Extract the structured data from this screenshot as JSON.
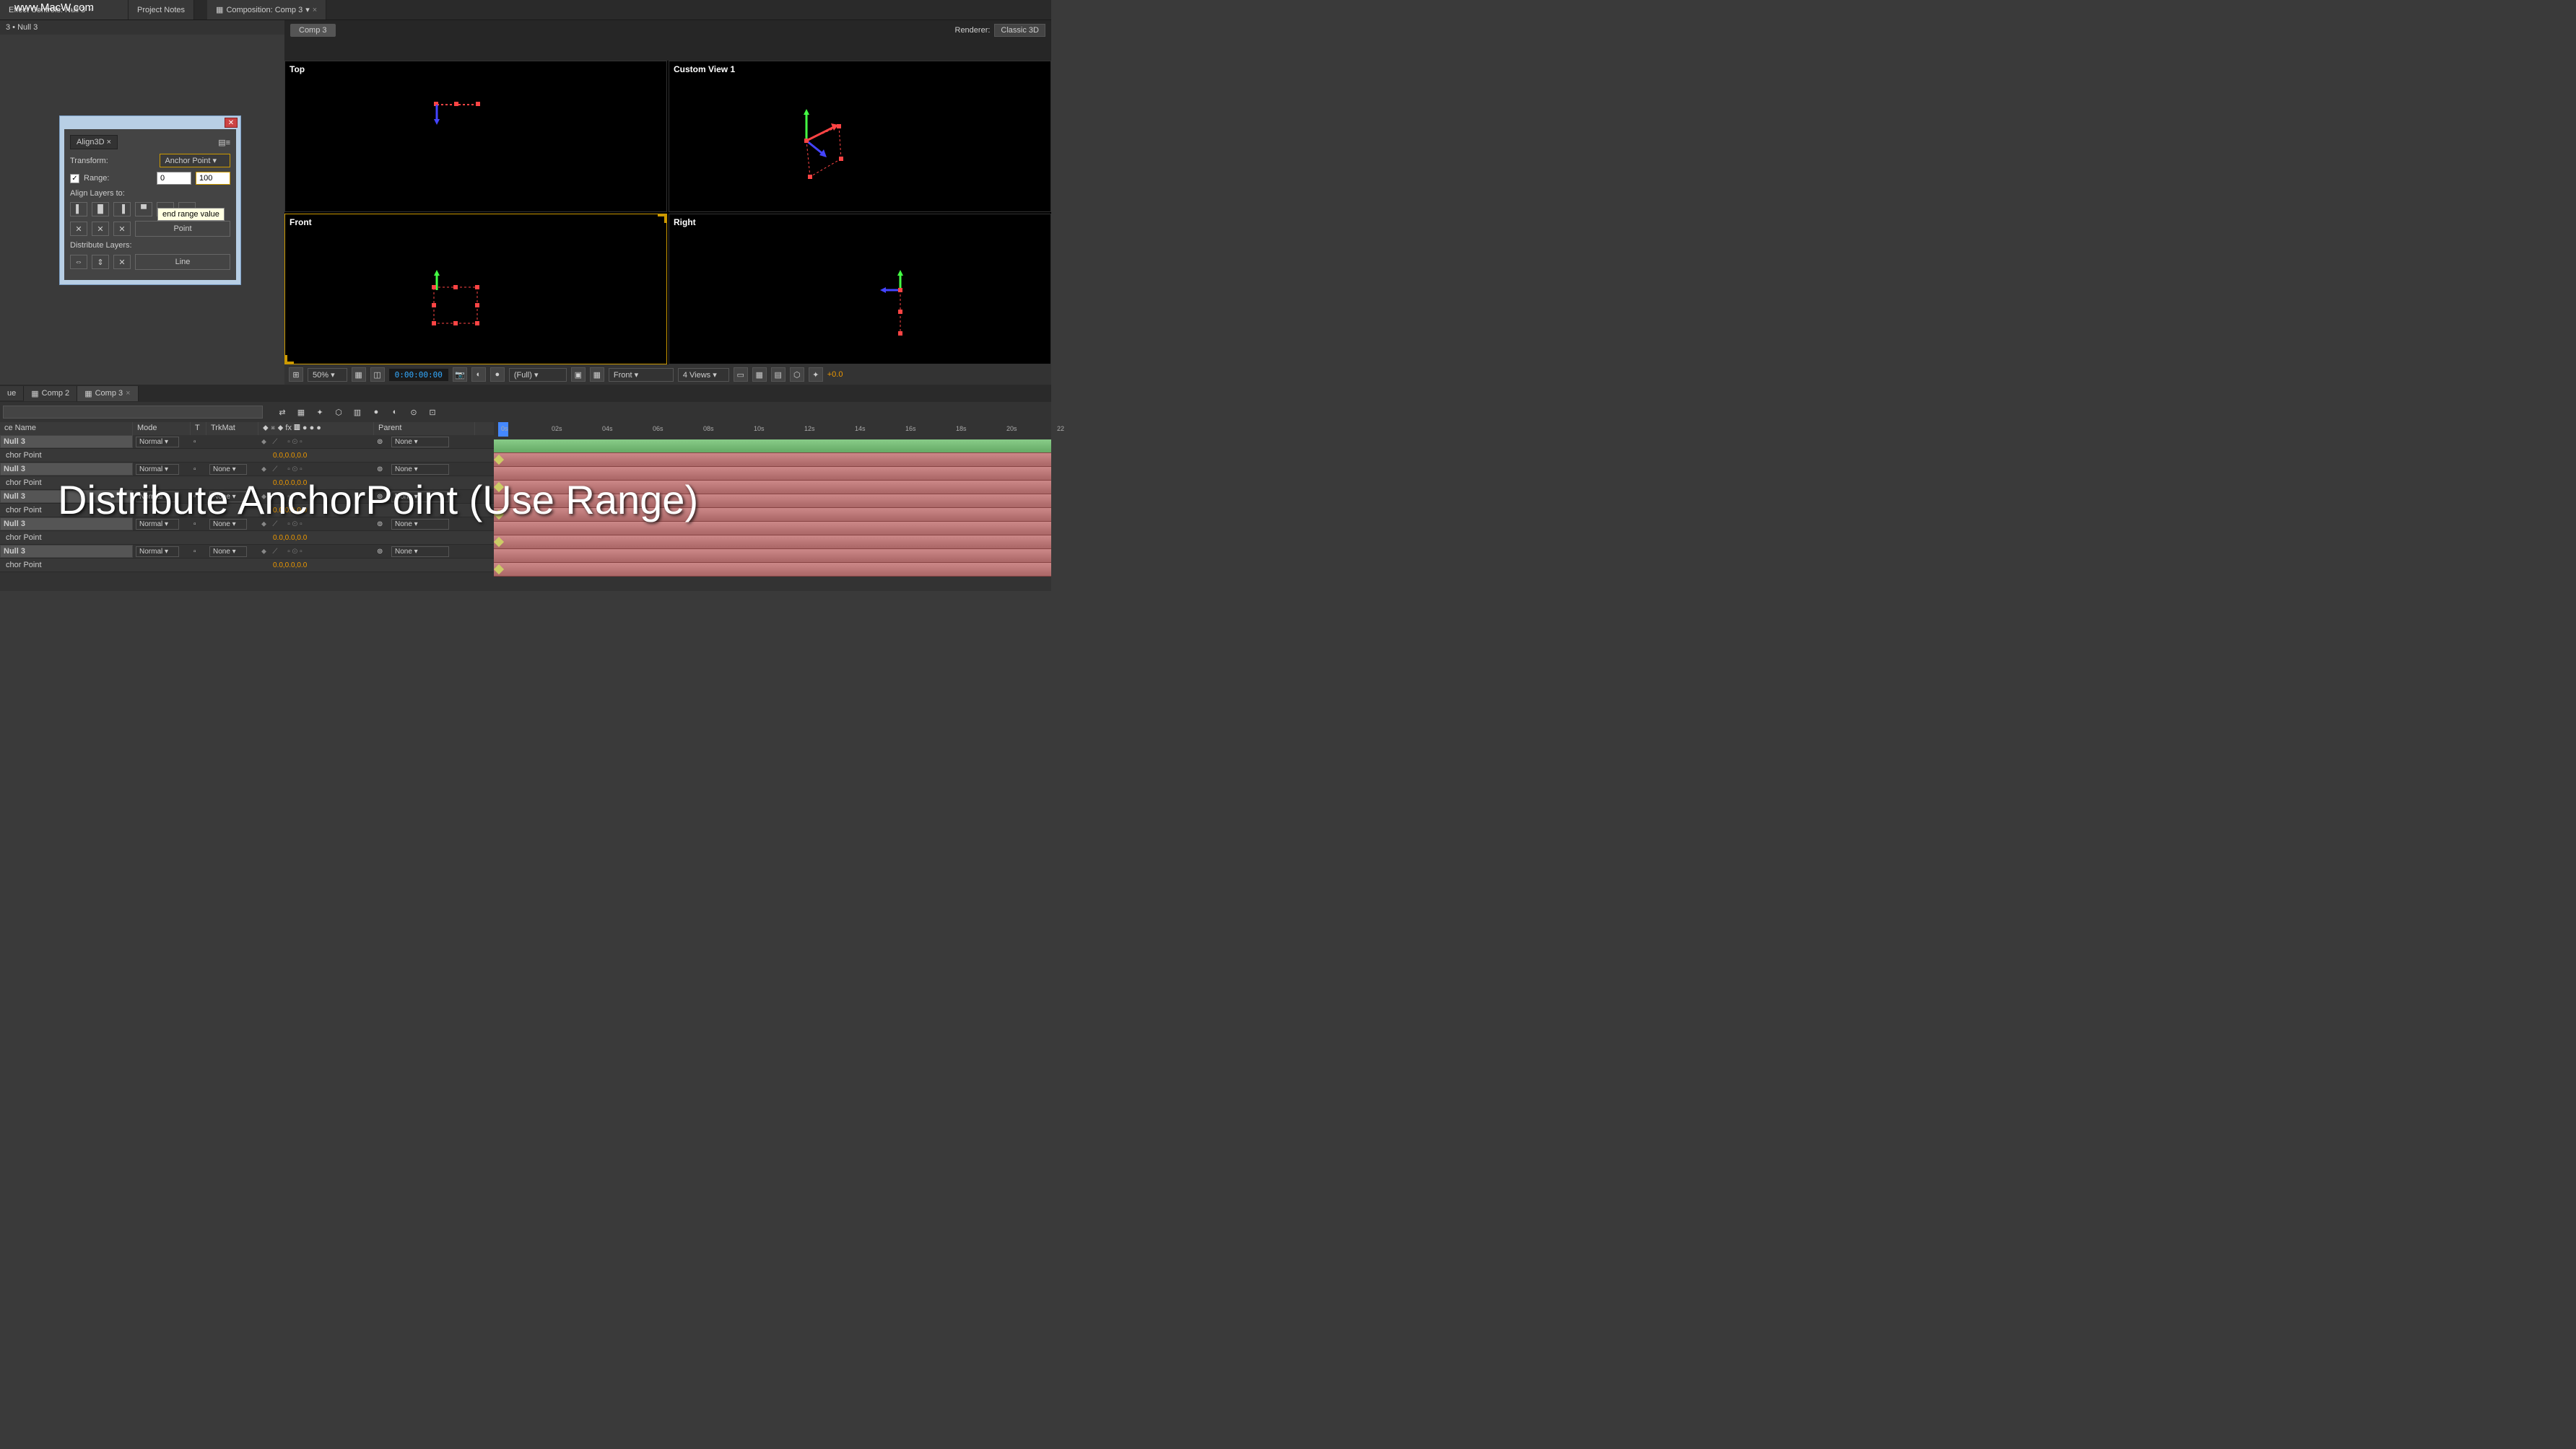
{
  "watermark": "www.MacW.com",
  "top_tabs": {
    "effect_controls": "Effect Controls: Null 3",
    "project_notes": "Project Notes"
  },
  "sublayer": "3 • Null 3",
  "comp_panel": {
    "title": "Composition: Comp 3",
    "active_comp": "Comp 3",
    "renderer_label": "Renderer:",
    "renderer_value": "Classic 3D"
  },
  "viewports": {
    "top": "Top",
    "custom": "Custom View 1",
    "front": "Front",
    "right": "Right"
  },
  "comp_footer": {
    "zoom": "50%",
    "timecode": "0:00:00:00",
    "resolution": "(Full)",
    "camera": "Front",
    "views": "4 Views",
    "exposure": "+0.0"
  },
  "align_dialog": {
    "tab": "Align3D",
    "transform_label": "Transform:",
    "transform_value": "Anchor Point",
    "range_label": "Range:",
    "range_start": "0",
    "range_end": "100",
    "align_label": "Align Layers to:",
    "tooltip": "end range value",
    "point_btn": "Point",
    "distribute_label": "Distribute Layers:",
    "line_btn": "Line"
  },
  "timeline": {
    "tabs": [
      "ue",
      "Comp 2",
      "Comp 3"
    ],
    "header": {
      "source": "ce Name",
      "mode": "Mode",
      "t": "T",
      "trkmat": "TrkMat",
      "parent": "Parent"
    },
    "ticks": [
      "0s",
      "02s",
      "04s",
      "06s",
      "08s",
      "10s",
      "12s",
      "14s",
      "16s",
      "18s",
      "20s",
      "22"
    ],
    "rows": [
      {
        "name": "Null 3",
        "mode": "Normal",
        "trkmat": "",
        "parent": "None",
        "val": ""
      },
      {
        "name": "chor Point",
        "prop": true,
        "val": "0.0,0.0,0.0"
      },
      {
        "name": "Null 3",
        "mode": "Normal",
        "trkmat": "None",
        "parent": "None",
        "val": ""
      },
      {
        "name": "chor Point",
        "prop": true,
        "val": "0.0,0.0,0.0"
      },
      {
        "name": "Null 3",
        "mode": "Normal",
        "trkmat": "None",
        "parent": "None",
        "val": ""
      },
      {
        "name": "chor Point",
        "prop": true,
        "val": "0.0,0.0,0.0"
      },
      {
        "name": "Null 3",
        "mode": "Normal",
        "trkmat": "None",
        "parent": "None",
        "val": ""
      },
      {
        "name": "chor Point",
        "prop": true,
        "val": "0.0,0.0,0.0"
      },
      {
        "name": "Null 3",
        "mode": "Normal",
        "trkmat": "None",
        "parent": "None",
        "val": ""
      },
      {
        "name": "chor Point",
        "prop": true,
        "val": "0.0,0.0,0.0"
      }
    ]
  },
  "overlay_text": "Distribute AnchorPoint (Use Range)"
}
